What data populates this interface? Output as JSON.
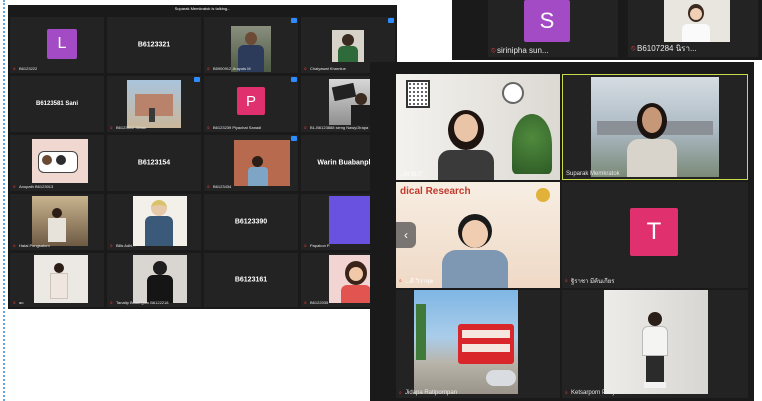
{
  "window1": {
    "talking_banner": "Suparak Memkratok is talking...",
    "tiles": [
      {
        "label": "B6123222",
        "center": "",
        "avatar_letter": "L",
        "avatar_color": "#a24bc4"
      },
      {
        "label": "",
        "center": "B6123321"
      },
      {
        "label": "B5900912 Jirayuts M",
        "center": ""
      },
      {
        "label": "Chaiyawat Kharnlue",
        "center": ""
      },
      {
        "label": "",
        "center": "B6123581 Sani"
      },
      {
        "label": "B6123512 Sirilak",
        "center": ""
      },
      {
        "label": "B6123239 Piyachat Sanadi",
        "center": "",
        "avatar_letter": "P",
        "avatar_color": "#e0306e"
      },
      {
        "label": "B1-B6123888 sieng Nawy/Jirapa",
        "center": ""
      },
      {
        "label": "Anupath B6123013",
        "center": ""
      },
      {
        "label": "",
        "center": "B6123154"
      },
      {
        "label": "B6123434",
        "center": ""
      },
      {
        "label": "",
        "center": "Warin Buabanph..."
      },
      {
        "label": "Hatai Pongsatorn",
        "center": ""
      },
      {
        "label": "Bills Adhi...",
        "center": ""
      },
      {
        "label": "",
        "center": "B6123390"
      },
      {
        "label": "Papakon P.",
        "center": ""
      },
      {
        "label": "ao",
        "center": ""
      },
      {
        "label": "Tanatip Buakngam B6122218",
        "center": ""
      },
      {
        "label": "",
        "center": "B6123161"
      },
      {
        "label": "B6122035",
        "center": ""
      }
    ]
  },
  "window2": {
    "tiles": [
      {
        "label": "sirinipha sun...",
        "avatar_letter": "S",
        "avatar_color": "#a24bc4"
      },
      {
        "label": "B6107284 นิรา..."
      }
    ]
  },
  "window3": {
    "tiles": [
      {
        "label": "...M SUT"
      },
      {
        "label": "Suparak Memkratok"
      },
      {
        "label": "...ดี วิวาหุด",
        "banner": "dical Research"
      },
      {
        "label": "ฐิราชา มีค้นเกียร",
        "avatar_letter": "T",
        "avatar_color": "#e0306e"
      },
      {
        "label": "Jidapa Ratipornpan"
      },
      {
        "label": "Ketsarporn Phoja"
      }
    ]
  }
}
